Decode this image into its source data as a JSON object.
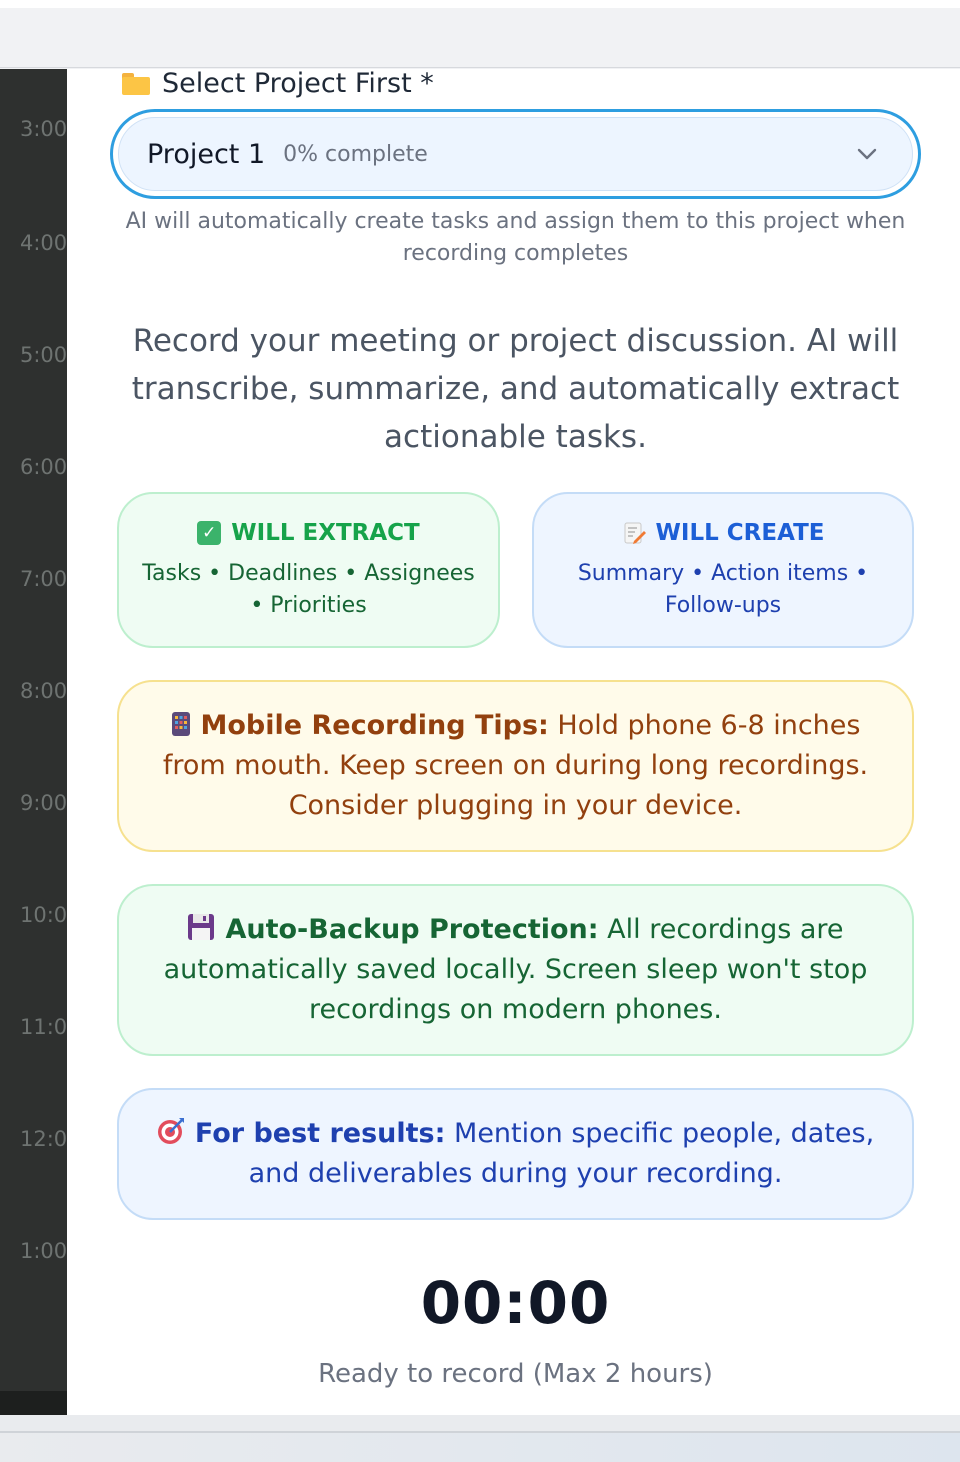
{
  "calendar": {
    "hours": [
      "3:00",
      "4:00",
      "5:00",
      "6:00",
      "7:00",
      "8:00",
      "9:00",
      "10:0",
      "11:0",
      "12:0",
      "1:00"
    ]
  },
  "project_select": {
    "label": "Select Project First *",
    "folder_icon": "folder-icon",
    "selected_name": "Project 1",
    "selected_progress": "0% complete",
    "helper": "AI will automatically create tasks and assign them to this project when recording completes"
  },
  "intro": "Record your meeting or project discussion. AI will transcribe, summarize, and automatically extract actionable tasks.",
  "cards": {
    "extract": {
      "title": "WILL EXTRACT",
      "body": "Tasks • Deadlines • Assignees • Priorities",
      "icon": "check-mark-icon"
    },
    "create": {
      "title": "WILL CREATE",
      "body": "Summary • Action items • Follow-ups",
      "icon": "memo-icon"
    }
  },
  "tips": {
    "mobile": {
      "title": "Mobile Recording Tips:",
      "text": " Hold phone 6-8 inches from mouth. Keep screen on during long recordings. Consider plugging in your device.",
      "icon": "mobile-phone-icon"
    },
    "backup": {
      "title": "Auto-Backup Protection:",
      "text": " All recordings are automatically saved locally. Screen sleep won't stop recordings on modern phones.",
      "icon": "floppy-disk-icon"
    },
    "best": {
      "title": "For best results:",
      "text": " Mention specific people, dates, and deliverables during your recording.",
      "icon": "target-icon"
    }
  },
  "recorder": {
    "timer": "00:00",
    "status": "Ready to record (Max 2 hours)"
  },
  "colors": {
    "select_border": "#2e9ee0",
    "green_text": "#16a34a",
    "blue_text": "#1d5fd6",
    "amber_text": "#92400e"
  }
}
